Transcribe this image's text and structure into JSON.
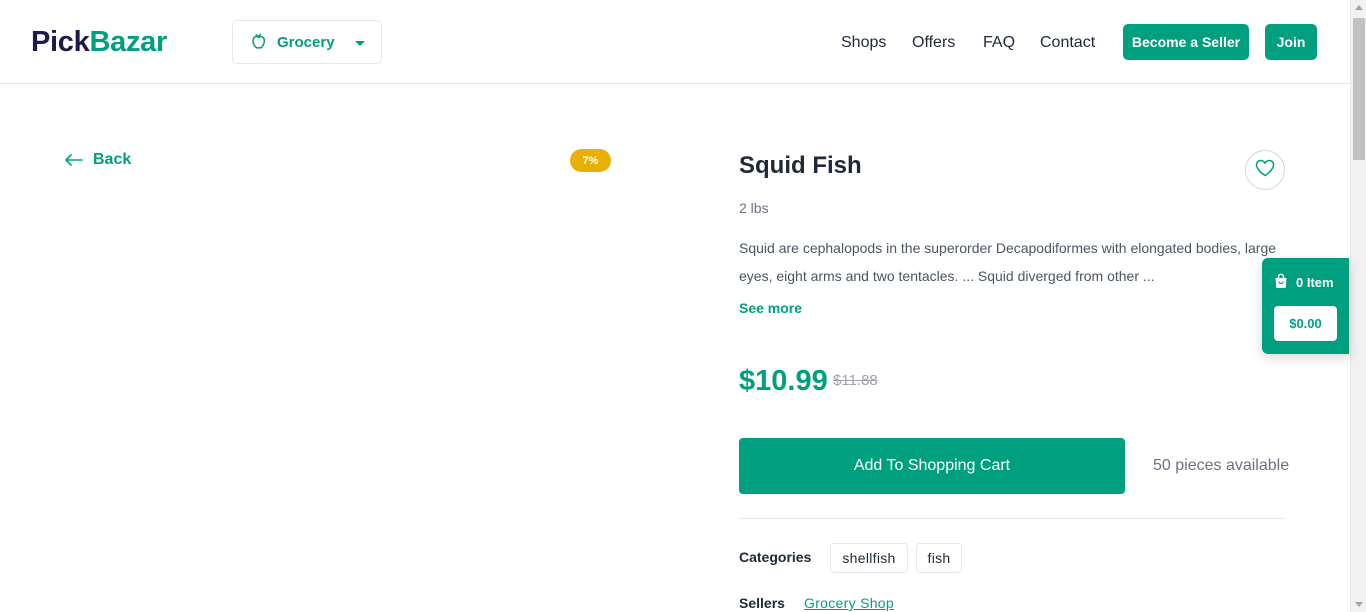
{
  "header": {
    "logo_part1": "Pick",
    "logo_part2": "Bazar",
    "group_selector": {
      "label": "Grocery",
      "icon": "apple-icon"
    },
    "nav": [
      "Shops",
      "Offers",
      "FAQ",
      "Contact"
    ],
    "become_seller_label": "Become a Seller",
    "join_label": "Join"
  },
  "back_label": "Back",
  "discount_badge": "7%",
  "product": {
    "title": "Squid Fish",
    "unit": "2 lbs",
    "description": "Squid are cephalopods in the superorder Decapodiformes with elongated bodies, large eyes, eight arms and two tentacles. ... Squid diverged from other ...",
    "see_more_label": "See more",
    "price": "$10.99",
    "original_price": "$11.88",
    "add_to_cart_label": "Add To Shopping Cart",
    "stock_text": "50 pieces available",
    "categories_label": "Categories",
    "categories": [
      "shellfish",
      "fish"
    ],
    "sellers_label": "Sellers",
    "seller": "Grocery Shop"
  },
  "cart": {
    "item_count_label": "0 Item",
    "total": "$0.00"
  },
  "colors": {
    "accent": "#009f7f",
    "logo_dark": "#1e1b4b",
    "badge": "#e7b007"
  }
}
